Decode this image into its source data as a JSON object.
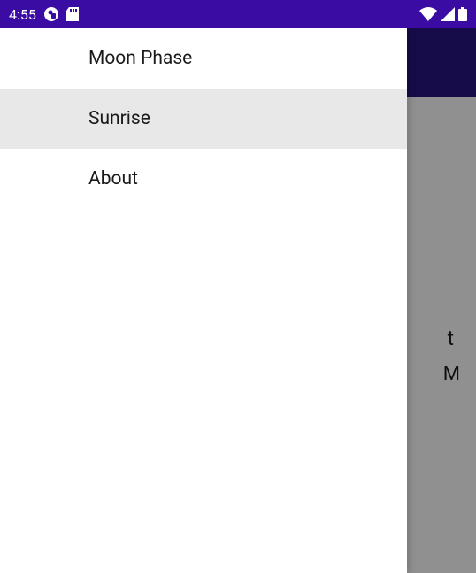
{
  "statusBar": {
    "time": "4:55"
  },
  "drawer": {
    "items": [
      {
        "label": "Moon Phase",
        "selected": false
      },
      {
        "label": "Sunrise",
        "selected": true
      },
      {
        "label": "About",
        "selected": false
      }
    ]
  },
  "mainContent": {
    "partialText1": "t",
    "partialText2": "M"
  }
}
